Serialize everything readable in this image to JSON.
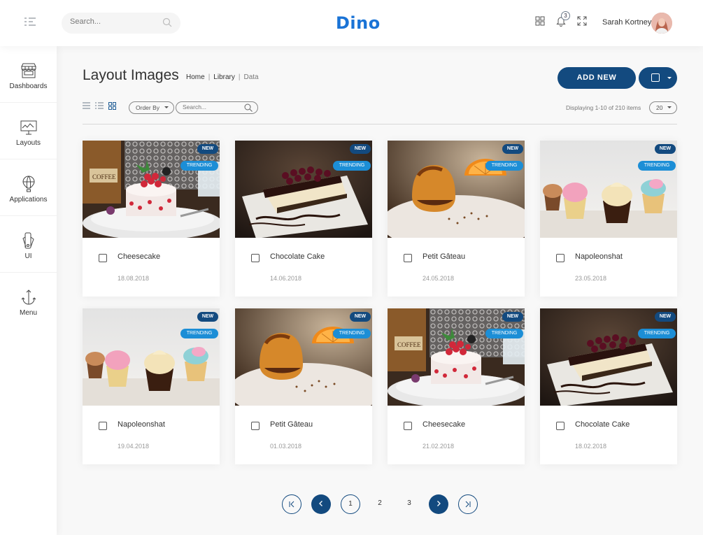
{
  "app": {
    "logo": "Dino"
  },
  "topbar": {
    "search_placeholder": "Search...",
    "notification_count": "3",
    "user_name": "Sarah Kortney"
  },
  "sidebar": {
    "items": [
      {
        "label": "Dashboards",
        "icon": "shop-icon"
      },
      {
        "label": "Layouts",
        "icon": "monitor-icon"
      },
      {
        "label": "Applications",
        "icon": "air-balloon-icon"
      },
      {
        "label": "UI",
        "icon": "pantone-icon"
      },
      {
        "label": "Menu",
        "icon": "anchor-icon"
      }
    ]
  },
  "header": {
    "title": "Layout Images",
    "breadcrumb": [
      "Home",
      "Library",
      "Data"
    ],
    "add_button": "ADD NEW"
  },
  "toolbar": {
    "order_by": "Order By",
    "search_placeholder": "Search...",
    "display_text": "Displaying 1-10 of 210 items",
    "per_page": "20"
  },
  "cards": [
    {
      "name": "Cheesecake",
      "date": "18.08.2018",
      "badge_new": "NEW",
      "badge_trending": "TRENDING",
      "image": "cheesecake"
    },
    {
      "name": "Chocolate Cake",
      "date": "14.06.2018",
      "badge_new": "NEW",
      "badge_trending": "TRENDING",
      "image": "chocolate-cake"
    },
    {
      "name": "Petit Gâteau",
      "date": "24.05.2018",
      "badge_new": "NEW",
      "badge_trending": "TRENDING",
      "image": "petit-gateau"
    },
    {
      "name": "Napoleonshat",
      "date": "23.05.2018",
      "badge_new": "NEW",
      "badge_trending": "TRENDING",
      "image": "cupcakes"
    },
    {
      "name": "Napoleonshat",
      "date": "19.04.2018",
      "badge_new": "NEW",
      "badge_trending": "TRENDING",
      "image": "cupcakes"
    },
    {
      "name": "Petit Gâteau",
      "date": "01.03.2018",
      "badge_new": "NEW",
      "badge_trending": "TRENDING",
      "image": "petit-gateau"
    },
    {
      "name": "Cheesecake",
      "date": "21.02.2018",
      "badge_new": "NEW",
      "badge_trending": "TRENDING",
      "image": "cheesecake"
    },
    {
      "name": "Chocolate Cake",
      "date": "18.02.2018",
      "badge_new": "NEW",
      "badge_trending": "TRENDING",
      "image": "chocolate-cake"
    }
  ],
  "pagination": {
    "pages": [
      "1",
      "2",
      "3"
    ],
    "current": "1"
  },
  "colors": {
    "primary": "#134a7f",
    "accent": "#1c8ed6",
    "logo": "#1a73d6"
  }
}
